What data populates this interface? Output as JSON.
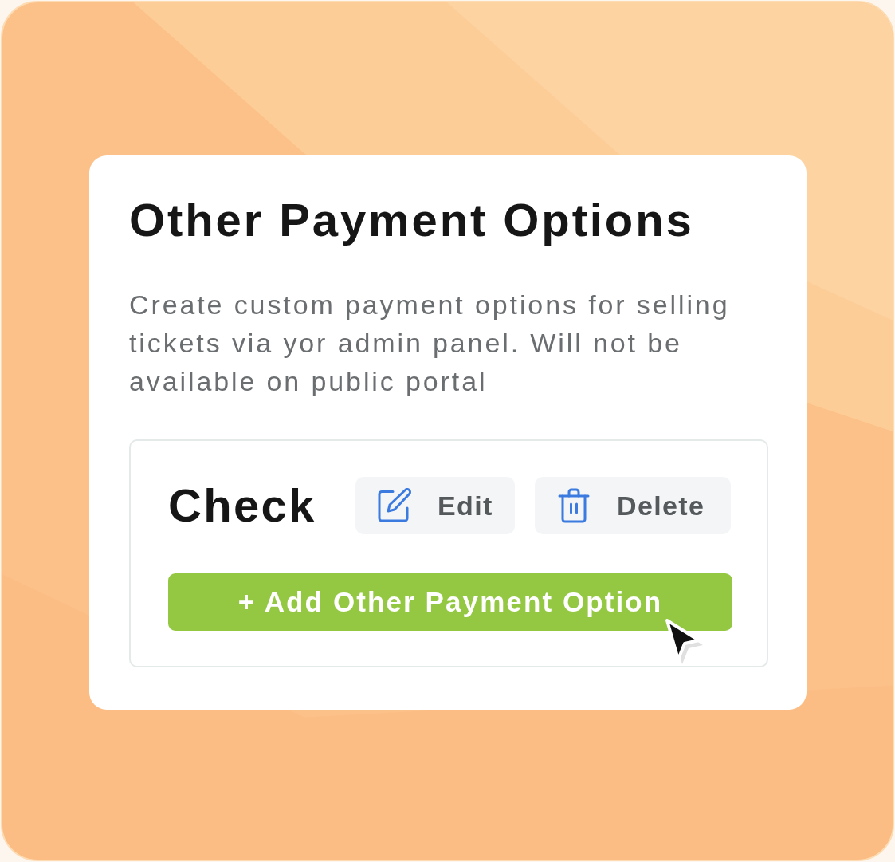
{
  "card": {
    "title": "Other Payment Options",
    "description": "Create custom payment options for selling tickets via yor admin panel. Will not be available on public portal"
  },
  "payment_options": [
    {
      "name": "Check",
      "actions": [
        {
          "kind": "edit",
          "label": "Edit"
        },
        {
          "kind": "delete",
          "label": "Delete"
        }
      ]
    }
  ],
  "add_button": {
    "label": "+ Add Other Payment Option"
  }
}
